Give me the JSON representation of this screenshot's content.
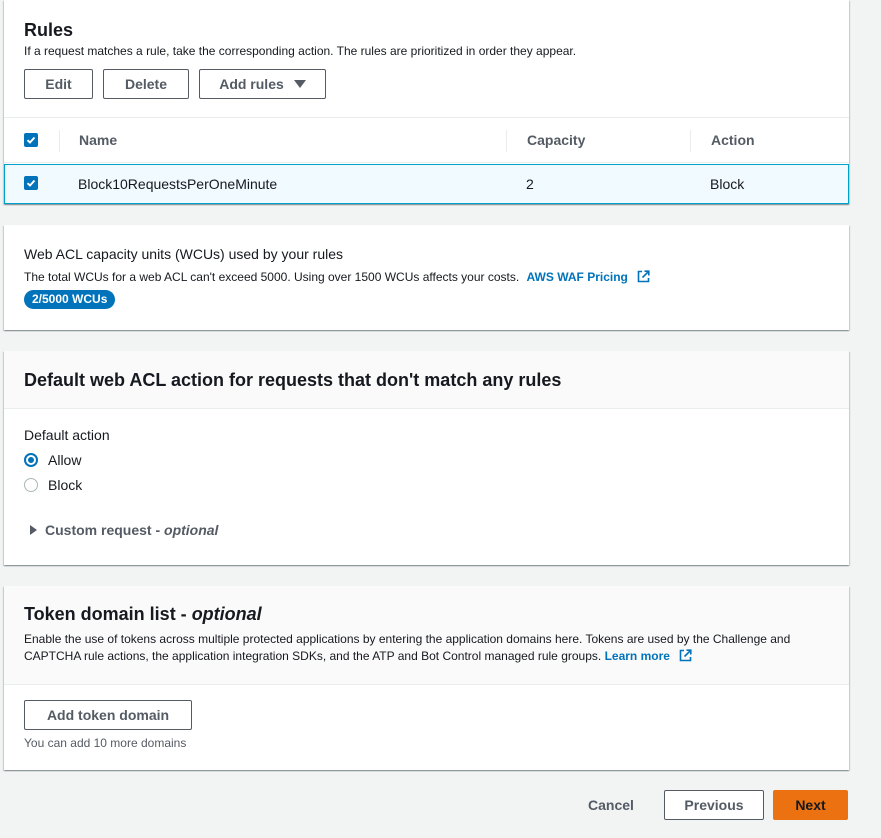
{
  "rules": {
    "title": "Rules",
    "description": "If a request matches a rule, take the corresponding action. The rules are prioritized in order they appear.",
    "buttons": {
      "edit": "Edit",
      "delete": "Delete",
      "add_rules": "Add rules"
    },
    "table": {
      "headers": {
        "name": "Name",
        "capacity": "Capacity",
        "action": "Action"
      },
      "rows": [
        {
          "name": "Block10RequestsPerOneMinute",
          "capacity": "2",
          "action": "Block",
          "selected": true
        }
      ]
    }
  },
  "wcu": {
    "title": "Web ACL capacity units (WCUs) used by your rules",
    "description": "The total WCUs for a web ACL can't exceed 5000. Using over 1500 WCUs affects your costs.",
    "pricing_link": "AWS WAF Pricing",
    "badge": "2/5000 WCUs"
  },
  "default_action": {
    "title": "Default web ACL action for requests that don't match any rules",
    "label": "Default action",
    "options": [
      {
        "label": "Allow",
        "selected": true
      },
      {
        "label": "Block",
        "selected": false
      }
    ],
    "custom_request": "Custom request - ",
    "custom_request_optional": "optional"
  },
  "token_domain": {
    "title": "Token domain list - ",
    "title_optional": "optional",
    "description": "Enable the use of tokens across multiple protected applications by entering the application domains here. Tokens are used by the Challenge and CAPTCHA rule actions, the application integration SDKs, and the ATP and Bot Control managed rule groups.",
    "learn_more": "Learn more",
    "add_button": "Add token domain",
    "hint": "You can add 10 more domains"
  },
  "footer": {
    "cancel": "Cancel",
    "previous": "Previous",
    "next": "Next"
  },
  "colors": {
    "accent": "#0073bb",
    "primary_button": "#ec7211",
    "selected_row_bg": "#f1faff",
    "selected_row_border": "#00a1c9"
  }
}
